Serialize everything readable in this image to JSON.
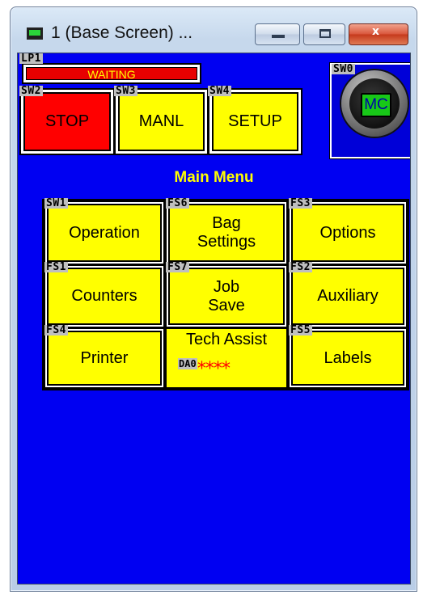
{
  "window": {
    "title": "1 (Base Screen) ...",
    "icon": "monitor-icon",
    "controls": {
      "minimize": "minimize-icon",
      "maximize": "maximize-icon",
      "close": "close-icon",
      "close_glyph": "x"
    }
  },
  "colors": {
    "background": "#0000f2",
    "button_yellow": "#ffff00",
    "button_red": "#ff0000",
    "lamp_red": "#e80000",
    "lamp_text": "#ffff00",
    "mc_green": "#18c818",
    "title_yellow": "#ffff00"
  },
  "lamp": {
    "tag": "LP1",
    "text": "WAITING"
  },
  "top_buttons": [
    {
      "tag": "SW2",
      "label": "STOP"
    },
    {
      "tag": "SW3",
      "label": "MANL"
    },
    {
      "tag": "SW4",
      "label": "SETUP"
    }
  ],
  "mc": {
    "tag": "SW0",
    "label": "MC"
  },
  "main_menu": {
    "title": "Main Menu",
    "rows": [
      [
        {
          "tag": "SW1",
          "label": "Operation"
        },
        {
          "tag": "FS6",
          "label": "Bag Settings"
        },
        {
          "tag": "FS3",
          "label": "Options"
        }
      ],
      [
        {
          "tag": "FS1",
          "label": "Counters"
        },
        {
          "tag": "FS7",
          "label": "Job Save"
        },
        {
          "tag": "FS2",
          "label": "Auxiliary"
        }
      ],
      [
        {
          "tag": "FS4",
          "label": "Printer"
        },
        {
          "tag": "",
          "label": "Tech Assist",
          "sub_tag": "DA0",
          "value": "****"
        },
        {
          "tag": "FS5",
          "label": "Labels"
        }
      ]
    ]
  }
}
